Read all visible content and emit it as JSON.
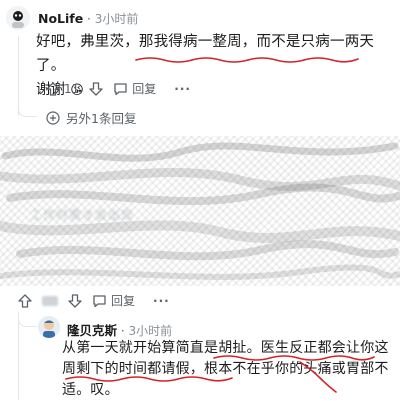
{
  "comment_top": {
    "username": "NoLife",
    "timestamp": "3小时前",
    "body_line1": "好吧，弗里茨，那我得病一整周，而不是只病一两天了。",
    "body_line2": "谢谢",
    "emoji": "😘",
    "upvotes": "11",
    "reply_label": "回复",
    "more_label": "···",
    "more_replies": "另外1条回复"
  },
  "comment_blurred": {
    "obscured_fragment": "工作时需才会出现"
  },
  "comment_reply": {
    "username": "隆贝克斯",
    "timestamp": "3小时前",
    "body_line1": "从第一天就开始算简直是胡扯。医生反正都会让你这",
    "body_line2": "周剩下的时间都请假，根本不在乎你的头痛或胃部不",
    "body_line3": "适。叹。"
  },
  "blurred_actions": {
    "reply_label": "回复",
    "more_label": "···"
  },
  "colors": {
    "annotation_red": "#d2232a",
    "meta_gray": "#5b6167",
    "avatar_bg": "#e9eef3"
  },
  "icons": [
    "upvote-icon",
    "downvote-icon",
    "comment-bubble-icon",
    "expand-plus-icon",
    "more-dots-icon"
  ]
}
